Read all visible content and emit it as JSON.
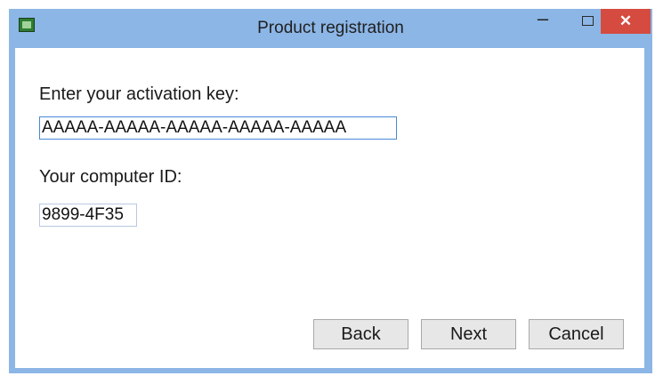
{
  "window": {
    "title": "Product registration",
    "icon": "app-icon",
    "controls": {
      "minimize": "–",
      "maximize": "",
      "close": "✕"
    }
  },
  "form": {
    "activation_key_label": "Enter your activation key:",
    "activation_key_value": "AAAAA-AAAAA-AAAAA-AAAAA-AAAAA",
    "computer_id_label": "Your computer ID:",
    "computer_id_value": "9899-4F35"
  },
  "buttons": {
    "back": "Back",
    "next": "Next",
    "cancel": "Cancel"
  },
  "colors": {
    "titlebar": "#8cb6e6",
    "close_button": "#d54b40",
    "button_face": "#e7e7e7"
  }
}
